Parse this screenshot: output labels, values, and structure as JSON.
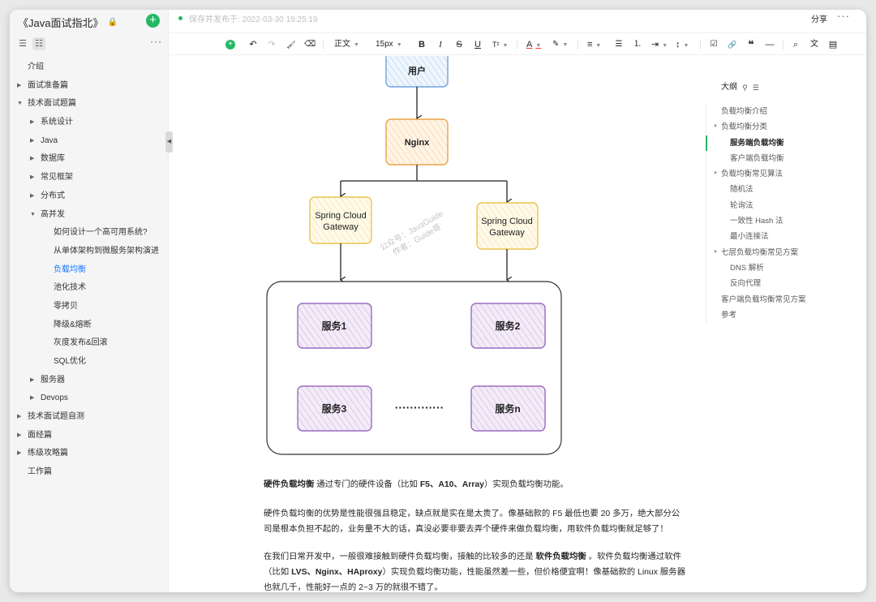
{
  "book": {
    "title": "《Java面试指北》",
    "lock_icon": "lock-icon"
  },
  "header": {
    "save_status": "保存并发布于: 2022-03-30 19:25:19",
    "share_label": "分享",
    "more_label": "···"
  },
  "sidebar": {
    "more_label": "···",
    "tree": [
      {
        "label": "介绍",
        "level": 0,
        "arrow": ""
      },
      {
        "label": "面试准备篇",
        "level": 0,
        "arrow": "▶"
      },
      {
        "label": "技术面试题篇",
        "level": 0,
        "arrow": "▼"
      },
      {
        "label": "系统设计",
        "level": 1,
        "arrow": "▶"
      },
      {
        "label": "Java",
        "level": 1,
        "arrow": "▶"
      },
      {
        "label": "数据库",
        "level": 1,
        "arrow": "▶"
      },
      {
        "label": "常见框架",
        "level": 1,
        "arrow": "▶"
      },
      {
        "label": "分布式",
        "level": 1,
        "arrow": "▶"
      },
      {
        "label": "高并发",
        "level": 1,
        "arrow": "▼"
      },
      {
        "label": "如何设计一个高可用系统?",
        "level": 2,
        "arrow": ""
      },
      {
        "label": "从单体架构到微服务架构演进",
        "level": 2,
        "arrow": ""
      },
      {
        "label": "负载均衡",
        "level": 2,
        "arrow": "",
        "active": true
      },
      {
        "label": "池化技术",
        "level": 2,
        "arrow": ""
      },
      {
        "label": "零拷贝",
        "level": 2,
        "arrow": ""
      },
      {
        "label": "降级&熔断",
        "level": 2,
        "arrow": ""
      },
      {
        "label": "灰度发布&回滚",
        "level": 2,
        "arrow": ""
      },
      {
        "label": "SQL优化",
        "level": 2,
        "arrow": ""
      },
      {
        "label": "服务器",
        "level": 1,
        "arrow": "▶"
      },
      {
        "label": "Devops",
        "level": 1,
        "arrow": "▶"
      },
      {
        "label": "技术面试题自测",
        "level": 0,
        "arrow": "▶"
      },
      {
        "label": "面经篇",
        "level": 0,
        "arrow": "▶"
      },
      {
        "label": "练级攻略篇",
        "level": 0,
        "arrow": "▶"
      },
      {
        "label": "工作篇",
        "level": 0,
        "arrow": ""
      }
    ]
  },
  "toolbar": {
    "insert": "+",
    "undo": "↶",
    "redo": "↷",
    "format_painter": "🖌",
    "clear_format": "⌫",
    "paragraph": "正文",
    "font_size": "15px",
    "bold": "B",
    "italic": "I",
    "strike": "S",
    "underline": "U",
    "sup_sub": "T²",
    "font_color": "A",
    "highlight": "✎",
    "align": "≡",
    "bullet_list": "☰",
    "ordered_list": "⒈",
    "indent": "⇥",
    "line_height": "↕",
    "task": "☑",
    "link": "🔗",
    "quote": "❝",
    "hr": "—",
    "find": "⌕",
    "translate": "文",
    "save": "▤"
  },
  "diagram": {
    "user": "用户",
    "nginx": "Nginx",
    "gateway_line1": "Spring Cloud",
    "gateway_line2": "Gateway",
    "svc1": "服务1",
    "svc2": "服务2",
    "svc3": "服务3",
    "svcn": "服务n",
    "dots": "·············",
    "watermark1": "公众号：JavaGuide",
    "watermark2": "作者：Guide哥",
    "colors": {
      "user": "#dbe9fb",
      "nginx": "#fde9cc",
      "gateway": "#fff2c4",
      "service": "#e5d7ee"
    }
  },
  "article": {
    "p1_bold": "硬件负载均衡",
    "p1_a": " 通过专门的硬件设备（比如 ",
    "p1_f5": "F5、A10、Array",
    "p1_b": "）实现负载均衡功能。",
    "p2": "硬件负载均衡的优势是性能很强且稳定，缺点就是实在是太贵了。像基础款的 F5 最低也要 20 多万，绝大部分公司是根本负担不起的，业务量不大的话，真没必要非要去弄个硬件来做负载均衡，用软件负载均衡就足够了！",
    "p3_a": "在我们日常开发中，一般很难接触到硬件负载均衡，接触的比较多的还是 ",
    "p3_bold": "软件负载均衡",
    "p3_b": " 。软件负载均衡通过软件（比如 ",
    "p3_bold2": "LVS、Nginx、HAproxy",
    "p3_c": "）实现负载均衡功能，性能虽然差一些，但价格便宜啊！像基础款的 Linux 服务器也就几千，性能好一点的 2~3 万的就很不错了。"
  },
  "outline": {
    "title": "大纲",
    "items": [
      {
        "label": "负载均衡介绍",
        "level": 0,
        "arrow": ""
      },
      {
        "label": "负载均衡分类",
        "level": 0,
        "arrow": "▼"
      },
      {
        "label": "服务端负载均衡",
        "level": 1,
        "arrow": "",
        "current": true
      },
      {
        "label": "客户端负载均衡",
        "level": 1,
        "arrow": ""
      },
      {
        "label": "负载均衡常见算法",
        "level": 0,
        "arrow": "▼"
      },
      {
        "label": "随机法",
        "level": 1,
        "arrow": ""
      },
      {
        "label": "轮询法",
        "level": 1,
        "arrow": ""
      },
      {
        "label": "一致性 Hash 法",
        "level": 1,
        "arrow": ""
      },
      {
        "label": "最小连接法",
        "level": 1,
        "arrow": ""
      },
      {
        "label": "七层负载均衡常见方案",
        "level": 0,
        "arrow": "▼"
      },
      {
        "label": "DNS 解析",
        "level": 1,
        "arrow": ""
      },
      {
        "label": "反向代理",
        "level": 1,
        "arrow": ""
      },
      {
        "label": "客户端负载均衡常见方案",
        "level": 0,
        "arrow": ""
      },
      {
        "label": "参考",
        "level": 0,
        "arrow": ""
      }
    ]
  }
}
